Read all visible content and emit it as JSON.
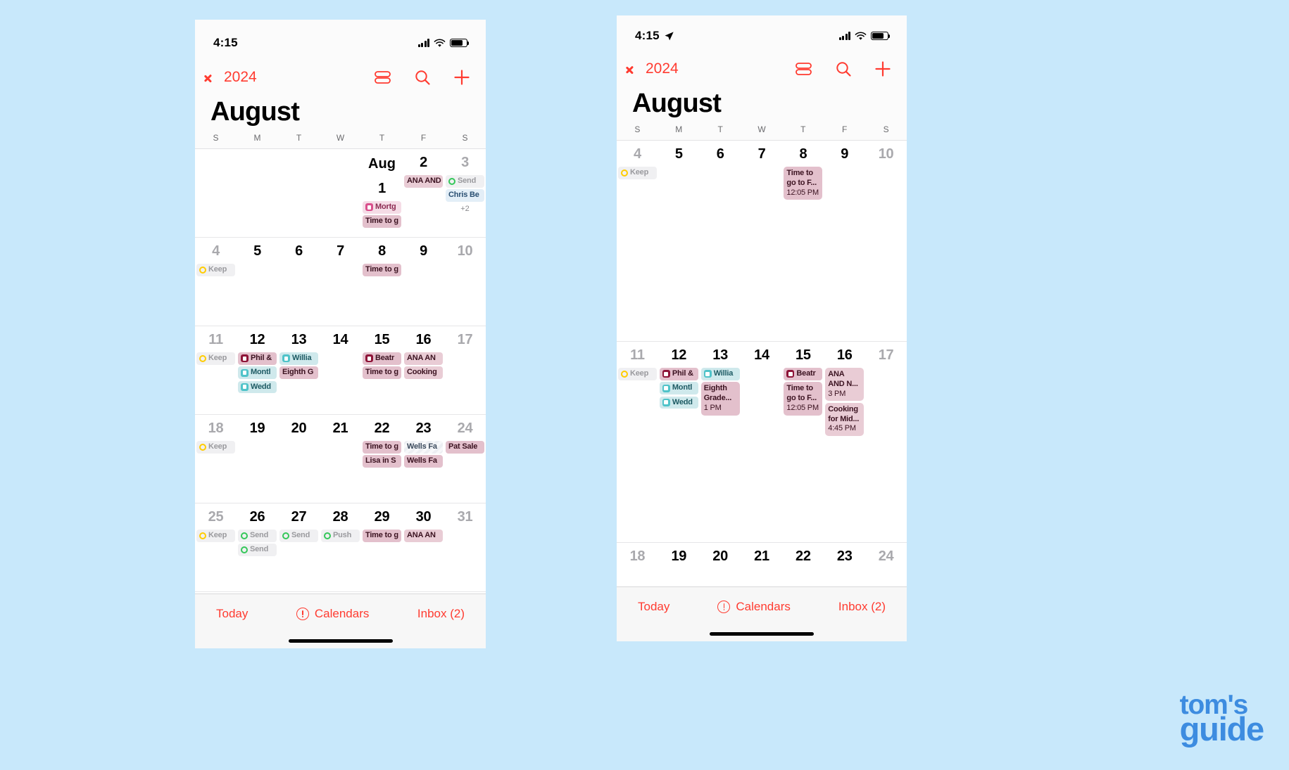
{
  "brand": {
    "line1": "tom's",
    "line2": "guide",
    "color": "#3d8ce0"
  },
  "accent": "#ff3b30",
  "phones": [
    {
      "id": "left",
      "status": {
        "time": "4:15",
        "location_arrow": false
      },
      "nav": {
        "back_label": "2024",
        "icons": [
          "list-view-icon",
          "search-icon",
          "add-icon"
        ]
      },
      "title": "August",
      "weekdays": [
        "S",
        "M",
        "T",
        "W",
        "T",
        "F",
        "S"
      ],
      "weeks": [
        {
          "days": [
            {
              "num": "",
              "blank": true
            },
            {
              "num": "",
              "blank": true
            },
            {
              "num": "",
              "blank": true
            },
            {
              "num": "",
              "blank": true
            },
            {
              "num": "1",
              "month_label": "Aug",
              "dim": false,
              "events": [
                {
                  "title": "Mortg",
                  "style": "c-rose",
                  "marker": "sqdot",
                  "marker_color": "#d94f8c"
                },
                {
                  "title": "Time to g",
                  "style": "c-pinkdeep",
                  "marker": "none"
                }
              ]
            },
            {
              "num": "2",
              "dim": false,
              "events": [
                {
                  "title": "ANA AND",
                  "style": "c-pink",
                  "marker": "none"
                }
              ]
            },
            {
              "num": "3",
              "dim": true,
              "events": [
                {
                  "title": "Send",
                  "style": "c-grey",
                  "marker": "dot",
                  "marker_color": "#34c759"
                },
                {
                  "title": "Chris Be",
                  "style": "c-blue",
                  "marker": "none"
                }
              ],
              "overflow": "+2"
            }
          ]
        },
        {
          "days": [
            {
              "num": "4",
              "dim": true,
              "events": [
                {
                  "title": "Keep",
                  "style": "c-grey",
                  "marker": "dot",
                  "marker_color": "#ffcc00"
                }
              ]
            },
            {
              "num": "5",
              "dim": false,
              "events": []
            },
            {
              "num": "6",
              "dim": false,
              "events": []
            },
            {
              "num": "7",
              "dim": false,
              "events": []
            },
            {
              "num": "8",
              "dim": false,
              "events": [
                {
                  "title": "Time to g",
                  "style": "c-pinkdeep",
                  "marker": "none"
                }
              ]
            },
            {
              "num": "9",
              "dim": false,
              "events": []
            },
            {
              "num": "10",
              "dim": true,
              "events": []
            }
          ]
        },
        {
          "days": [
            {
              "num": "11",
              "dim": true,
              "events": [
                {
                  "title": "Keep",
                  "style": "c-grey",
                  "marker": "dot",
                  "marker_color": "#ffcc00"
                }
              ]
            },
            {
              "num": "12",
              "dim": false,
              "events": [
                {
                  "title": "Phil &",
                  "style": "c-pinkdeep",
                  "marker": "sqdot",
                  "marker_color": "#8e1438"
                },
                {
                  "title": "Montl",
                  "style": "c-teal",
                  "marker": "sqdot",
                  "marker_color": "#4fc3c9"
                },
                {
                  "title": "Wedd",
                  "style": "c-teal",
                  "marker": "sqdot",
                  "marker_color": "#4fc3c9"
                }
              ]
            },
            {
              "num": "13",
              "dim": false,
              "events": [
                {
                  "title": "Willia",
                  "style": "c-teal",
                  "marker": "sqdot",
                  "marker_color": "#4fc3c9"
                },
                {
                  "title": "Eighth G",
                  "style": "c-pinkdeep",
                  "marker": "none"
                }
              ]
            },
            {
              "num": "14",
              "dim": false,
              "events": []
            },
            {
              "num": "15",
              "dim": false,
              "events": [
                {
                  "title": "Beatr",
                  "style": "c-pinkdeep",
                  "marker": "sqdot",
                  "marker_color": "#8e1438"
                },
                {
                  "title": "Time to g",
                  "style": "c-pinkdeep",
                  "marker": "none"
                }
              ]
            },
            {
              "num": "16",
              "dim": false,
              "events": [
                {
                  "title": "ANA AN",
                  "style": "c-pink",
                  "marker": "none"
                },
                {
                  "title": "Cooking",
                  "style": "c-pink",
                  "marker": "none"
                }
              ]
            },
            {
              "num": "17",
              "dim": true,
              "events": []
            }
          ]
        },
        {
          "days": [
            {
              "num": "18",
              "dim": true,
              "events": [
                {
                  "title": "Keep",
                  "style": "c-grey",
                  "marker": "dot",
                  "marker_color": "#ffcc00"
                }
              ]
            },
            {
              "num": "19",
              "dim": false,
              "events": []
            },
            {
              "num": "20",
              "dim": false,
              "events": []
            },
            {
              "num": "21",
              "dim": false,
              "events": []
            },
            {
              "num": "22",
              "dim": false,
              "events": [
                {
                  "title": "Time to g",
                  "style": "c-pinkdeep",
                  "marker": "none"
                },
                {
                  "title": "Lisa in S",
                  "style": "c-pinkdeep",
                  "marker": "none"
                }
              ]
            },
            {
              "num": "23",
              "dim": false,
              "events": [
                {
                  "title": "Wells Fa",
                  "style": "c-hatch",
                  "marker": "none"
                },
                {
                  "title": "Wells Fa",
                  "style": "c-pinkdeep",
                  "marker": "none"
                }
              ]
            },
            {
              "num": "24",
              "dim": true,
              "events": [
                {
                  "title": "Pat Sale",
                  "style": "c-pinkdeep",
                  "marker": "none"
                }
              ]
            }
          ]
        },
        {
          "days": [
            {
              "num": "25",
              "dim": true,
              "events": [
                {
                  "title": "Keep",
                  "style": "c-grey",
                  "marker": "dot",
                  "marker_color": "#ffcc00"
                }
              ]
            },
            {
              "num": "26",
              "dim": false,
              "events": [
                {
                  "title": "Send",
                  "style": "c-grey",
                  "marker": "dot",
                  "marker_color": "#34c759"
                },
                {
                  "title": "Send",
                  "style": "c-grey",
                  "marker": "dot",
                  "marker_color": "#34c759"
                }
              ]
            },
            {
              "num": "27",
              "dim": false,
              "events": [
                {
                  "title": "Send",
                  "style": "c-grey",
                  "marker": "dot",
                  "marker_color": "#34c759"
                }
              ]
            },
            {
              "num": "28",
              "dim": false,
              "events": [
                {
                  "title": "Push",
                  "style": "c-grey",
                  "marker": "dot",
                  "marker_color": "#34c759"
                }
              ]
            },
            {
              "num": "29",
              "dim": false,
              "events": [
                {
                  "title": "Time to g",
                  "style": "c-pinkdeep",
                  "marker": "none"
                }
              ]
            },
            {
              "num": "30",
              "dim": false,
              "events": [
                {
                  "title": "ANA AN",
                  "style": "c-pink",
                  "marker": "none"
                }
              ]
            },
            {
              "num": "31",
              "dim": true,
              "events": []
            }
          ]
        }
      ],
      "toolbar": {
        "today": "Today",
        "calendars": "Calendars",
        "inbox": "Inbox (2)"
      }
    },
    {
      "id": "right",
      "status": {
        "time": "4:15",
        "location_arrow": true
      },
      "nav": {
        "back_label": "2024",
        "icons": [
          "list-view-icon",
          "search-icon",
          "add-icon"
        ]
      },
      "title": "August",
      "weekdays": [
        "S",
        "M",
        "T",
        "W",
        "T",
        "F",
        "S"
      ],
      "weeks": [
        {
          "days": [
            {
              "num": "4",
              "dim": true,
              "events": [
                {
                  "title": "Keep",
                  "style": "c-grey",
                  "marker": "dot",
                  "marker_color": "#ffcc00"
                }
              ]
            },
            {
              "num": "5",
              "dim": false,
              "events": []
            },
            {
              "num": "6",
              "dim": false,
              "events": []
            },
            {
              "num": "7",
              "dim": false,
              "events": []
            },
            {
              "num": "8",
              "dim": false,
              "events": [
                {
                  "title": "Time to go to F...",
                  "time": "12:05 PM",
                  "style": "c-pinkdeep",
                  "marker": "none",
                  "tall": true
                }
              ]
            },
            {
              "num": "9",
              "dim": false,
              "events": []
            },
            {
              "num": "10",
              "dim": true,
              "events": []
            }
          ]
        },
        {
          "days": [
            {
              "num": "11",
              "dim": true,
              "events": [
                {
                  "title": "Keep",
                  "style": "c-grey",
                  "marker": "dot",
                  "marker_color": "#ffcc00"
                }
              ]
            },
            {
              "num": "12",
              "dim": false,
              "events": [
                {
                  "title": "Phil &",
                  "style": "c-pinkdeep",
                  "marker": "sqdot",
                  "marker_color": "#8e1438"
                },
                {
                  "title": "Montl",
                  "style": "c-teal",
                  "marker": "sqdot",
                  "marker_color": "#4fc3c9"
                },
                {
                  "title": "Wedd",
                  "style": "c-teal",
                  "marker": "sqdot",
                  "marker_color": "#4fc3c9"
                }
              ]
            },
            {
              "num": "13",
              "dim": false,
              "events": [
                {
                  "title": "Willia",
                  "style": "c-teal",
                  "marker": "sqdot",
                  "marker_color": "#4fc3c9"
                },
                {
                  "title": "Eighth Grade...",
                  "time": "1 PM",
                  "style": "c-pinkdeep",
                  "marker": "none",
                  "tall": true
                }
              ]
            },
            {
              "num": "14",
              "dim": false,
              "events": []
            },
            {
              "num": "15",
              "dim": false,
              "events": [
                {
                  "title": "Beatr",
                  "style": "c-pinkdeep",
                  "marker": "sqdot",
                  "marker_color": "#8e1438"
                },
                {
                  "title": "Time to go to F...",
                  "time": "12:05 PM",
                  "style": "c-pinkdeep",
                  "marker": "none",
                  "tall": true
                }
              ]
            },
            {
              "num": "16",
              "dim": false,
              "events": [
                {
                  "title": "ANA AND N...",
                  "time": "3 PM",
                  "style": "c-pink",
                  "marker": "none",
                  "tall": true
                },
                {
                  "title": "Cooking for Mid...",
                  "time": "4:45 PM",
                  "style": "c-pink",
                  "marker": "none",
                  "tall": true
                }
              ]
            },
            {
              "num": "17",
              "dim": true,
              "events": []
            }
          ]
        },
        {
          "days": [
            {
              "num": "18",
              "dim": true,
              "events": []
            },
            {
              "num": "19",
              "dim": false,
              "events": []
            },
            {
              "num": "20",
              "dim": false,
              "events": []
            },
            {
              "num": "21",
              "dim": false,
              "events": []
            },
            {
              "num": "22",
              "dim": false,
              "events": []
            },
            {
              "num": "23",
              "dim": false,
              "events": []
            },
            {
              "num": "24",
              "dim": true,
              "events": []
            }
          ]
        }
      ],
      "toolbar": {
        "today": "Today",
        "calendars": "Calendars",
        "inbox": "Inbox (2)"
      }
    }
  ]
}
